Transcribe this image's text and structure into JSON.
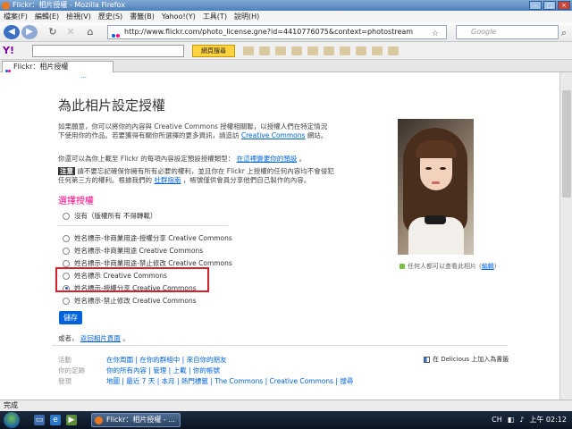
{
  "window": {
    "title": "Flickr：相片授權 - Mozilla Firefox"
  },
  "menubar": {
    "items": [
      "檔案(F)",
      "編輯(E)",
      "檢視(V)",
      "歷史(S)",
      "書籤(B)",
      "Yahoo!(Y)",
      "工具(T)",
      "說明(H)"
    ]
  },
  "navbar": {
    "url": "http://www.flickr.com/photo_license.gne?id=4410776075&context=photostream",
    "search_placeholder": "Google"
  },
  "yahoo_toolbar": {
    "logo": "Y!",
    "search_button": "網頁搜尋"
  },
  "tab": {
    "label": "Flickr：相片授權"
  },
  "page": {
    "title": "為此相片設定授權",
    "intro": "如果願意，你可以將你的內容與 Creative Commons 授權相關聯，以授權人們在特定情況下使用你的作品。若要獲得有關你所選擇的更多資訊，請造訪",
    "intro_link": "Creative Commons",
    "intro_tail": "網站。",
    "intro2": "你還可以為你上載至 Flickr 的每項內容設定預設授權類型：",
    "intro2_link": "在這裡變更你的預設",
    "intro2_tail": "。",
    "note_label": "注意",
    "note_text": "請不要忘記確保你擁有所有必要的權利，並且你在 Flickr 上授權的任何內容均不會侵犯任何第三方的權利。根據我們的",
    "note_link": "社群指南",
    "note_tail": "，帳號僅供會員分享他們自己製作的內容。",
    "choose_heading": "選擇授權",
    "options": [
      "沒有（版權所有 不得轉載）",
      "姓名標示-非商業用途-授權分享 Creative Commons",
      "姓名標示-非商業用途 Creative Commons",
      "姓名標示-非商業用途-禁止修改 Creative Commons",
      "姓名標示 Creative Commons",
      "姓名標示-授權分享 Creative Commons",
      "姓名標示-禁止修改 Creative Commons"
    ],
    "selected_index": 5,
    "save_button": "儲存",
    "back_prefix": "或者，",
    "back_link": "返回相片頁面",
    "back_tail": "。",
    "photo_caption": "任何人都可以查看此相片",
    "photo_caption_link": "編輯",
    "top_cutoff": "…"
  },
  "footer": {
    "rows": [
      {
        "label": "活動",
        "links": "在你周圍 | 在你的群組中 | 來自你的朋友"
      },
      {
        "label": "你的足跡",
        "links": "你的所有內容 | 管理 | 上載 | 你的帳號"
      },
      {
        "label": "發現",
        "links": "地圖 | 最近 7 天 | 本月 | 熱門標籤 | The Commons | Creative Commons | 搜尋"
      }
    ],
    "delicious": "在 Delicious 上加入為書籤"
  },
  "statusbar": {
    "text": "完成"
  },
  "taskbar": {
    "item": "Flickr：相片授權 - ...",
    "lang": "CH",
    "clock": "上午 02:12"
  }
}
